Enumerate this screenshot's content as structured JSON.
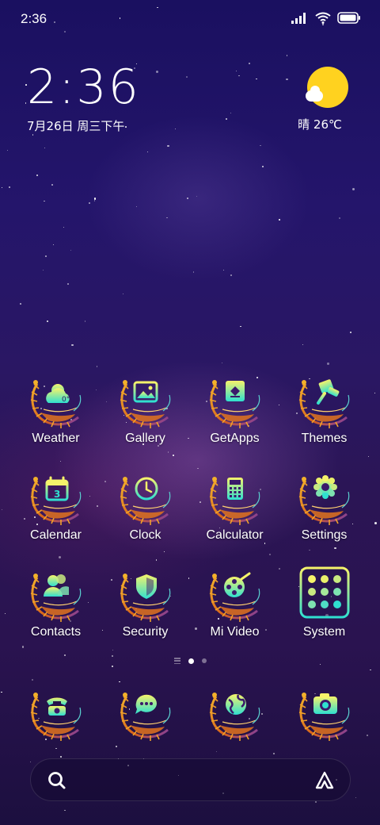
{
  "status_bar": {
    "time": "2:36"
  },
  "clock_widget": {
    "time": "2:36",
    "date": "7月26日 周三下午"
  },
  "weather_widget": {
    "text": "晴 26℃"
  },
  "apps": [
    {
      "label": "Weather",
      "icon": "weather-icon"
    },
    {
      "label": "Gallery",
      "icon": "gallery-icon"
    },
    {
      "label": "GetApps",
      "icon": "getapps-icon"
    },
    {
      "label": "Themes",
      "icon": "themes-icon"
    },
    {
      "label": "Calendar",
      "icon": "calendar-icon"
    },
    {
      "label": "Clock",
      "icon": "clock-icon"
    },
    {
      "label": "Calculator",
      "icon": "calculator-icon"
    },
    {
      "label": "Settings",
      "icon": "settings-icon"
    },
    {
      "label": "Contacts",
      "icon": "contacts-icon"
    },
    {
      "label": "Security",
      "icon": "security-icon"
    },
    {
      "label": "Mi Video",
      "icon": "mi-video-icon"
    },
    {
      "label": "System",
      "icon": "system-folder-icon"
    }
  ],
  "dock": [
    {
      "icon": "phone-icon"
    },
    {
      "icon": "messages-icon"
    },
    {
      "icon": "browser-icon"
    },
    {
      "icon": "camera-icon"
    }
  ],
  "page_indicator": {
    "current_page": 1
  },
  "colors": {
    "icon_glow": "#f2f25a",
    "icon_teal": "#2fe0d0",
    "feather_orange": "#e08a1e",
    "sun": "#ffd21f"
  }
}
